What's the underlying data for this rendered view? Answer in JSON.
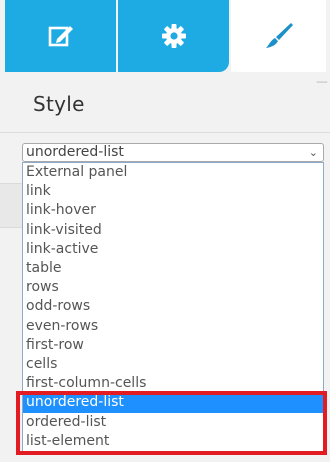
{
  "tabs": [
    {
      "icon": "edit-icon"
    },
    {
      "icon": "gear-icon"
    },
    {
      "icon": "brush-icon"
    }
  ],
  "colors": {
    "tab_active_bg": "#1eaae2",
    "selected_option_bg": "#1e90ff",
    "highlight_border": "#e31b23"
  },
  "panel": {
    "title": "Style"
  },
  "selector": {
    "selected_value": "unordered-list",
    "options": [
      "External panel",
      "link",
      "link-hover",
      "link-visited",
      "link-active",
      "table",
      "rows",
      "odd-rows",
      "even-rows",
      "first-row",
      "cells",
      "first-column-cells",
      "unordered-list",
      "ordered-list",
      "list-element"
    ]
  }
}
